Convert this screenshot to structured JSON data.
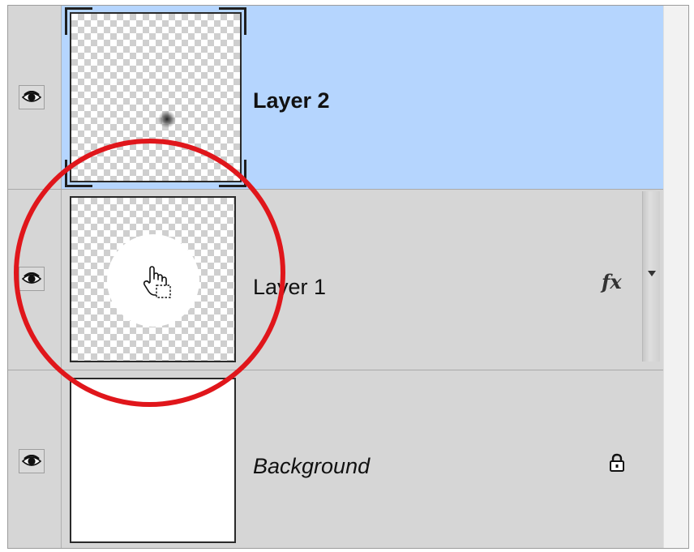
{
  "layers": [
    {
      "name": "Layer 2",
      "selected": true,
      "has_fx": false,
      "locked": false,
      "thumbnail": "transparent-with-dot"
    },
    {
      "name": "Layer 1",
      "selected": false,
      "has_fx": true,
      "locked": false,
      "thumbnail": "transparent-with-hand-cursor"
    },
    {
      "name": "Background",
      "selected": false,
      "has_fx": false,
      "locked": true,
      "thumbnail": "white-fill"
    }
  ],
  "icons": {
    "visibility": "eye-icon",
    "effects": "fx-icon",
    "lock": "lock-icon",
    "cursor": "hand-cursor-icon"
  },
  "fx_label": "fx",
  "colors": {
    "selection": "#b5d5fe",
    "panel": "#d6d6d6",
    "highlight_circle": "#e0161b"
  }
}
